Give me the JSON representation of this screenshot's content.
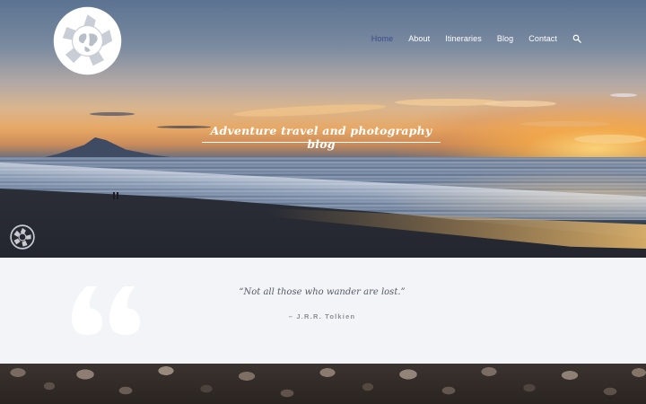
{
  "site": {
    "logo_icon": "aperture-globe-logo",
    "watermark_icon": "aperture-watermark-icon",
    "tagline": "Adventure travel and photography blog"
  },
  "nav": {
    "items": [
      {
        "label": "Home",
        "active": true
      },
      {
        "label": "About",
        "active": false
      },
      {
        "label": "Itineraries",
        "active": false
      },
      {
        "label": "Blog",
        "active": false
      },
      {
        "label": "Contact",
        "active": false
      }
    ],
    "search_icon": "search-icon",
    "active_color": "#3a4a8a",
    "text_color": "#ffffff"
  },
  "quote": {
    "text": "“Not all those who wander are lost.”",
    "author": "– J.R.R. Tolkien",
    "icon": "quote-mark-icon"
  },
  "colors": {
    "quote_bg": "#f3f4f7",
    "quote_text": "#555b66",
    "author_text": "#8a8e96"
  }
}
